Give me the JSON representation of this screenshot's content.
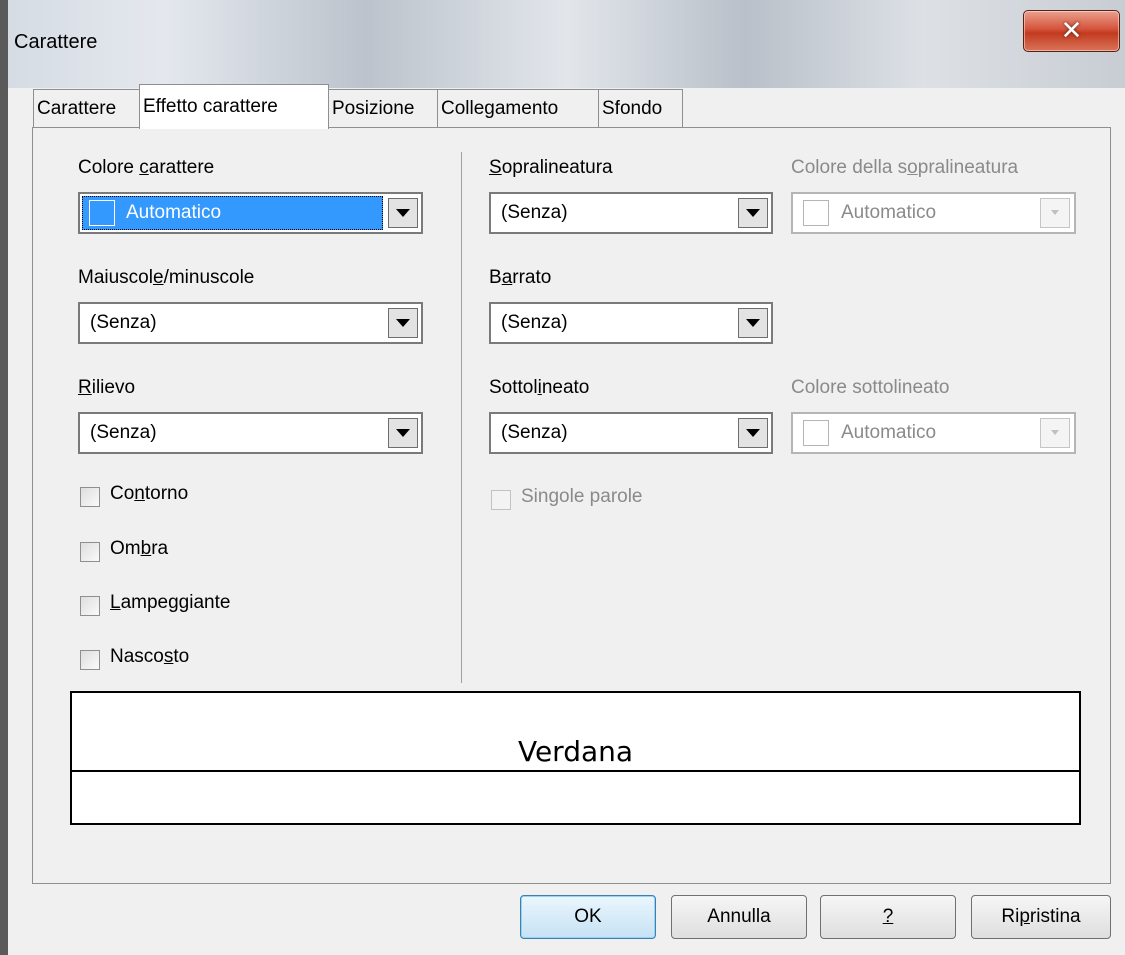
{
  "window": {
    "title": "Carattere",
    "close_glyph": "✕"
  },
  "tabs": [
    {
      "label": "Carattere",
      "active": false
    },
    {
      "label": "Effetto carattere",
      "active": true
    },
    {
      "label": "Posizione",
      "active": false
    },
    {
      "label": "Collegamento",
      "active": false
    },
    {
      "label": "Sfondo",
      "active": false
    }
  ],
  "left_column": {
    "font_color": {
      "label_pre": "Colore ",
      "label_key": "c",
      "label_post": "arattere",
      "value": "Automatico"
    },
    "case": {
      "label_pre": "Maiuscol",
      "label_key": "e",
      "label_post": "/minuscole",
      "value": "(Senza)"
    },
    "relief": {
      "label_pre": "",
      "label_key": "R",
      "label_post": "ilievo",
      "value": "(Senza)"
    },
    "checkboxes": [
      {
        "pre": "Co",
        "key": "n",
        "post": "torno",
        "checked": false
      },
      {
        "pre": "Om",
        "key": "b",
        "post": "ra",
        "checked": false
      },
      {
        "pre": "",
        "key": "L",
        "post": "ampeggiante",
        "checked": false
      },
      {
        "pre": "Nasco",
        "key": "s",
        "post": "to",
        "checked": false
      }
    ]
  },
  "right_column": {
    "overline": {
      "label_pre": "",
      "label_key": "S",
      "label_post": "opralineatura",
      "value": "(Senza)"
    },
    "overline_color": {
      "label_pre": "Colore della s",
      "label_key": "o",
      "label_post": "pralineatura",
      "value": "Automatico",
      "disabled": true
    },
    "strikethrough": {
      "label_pre": "B",
      "label_key": "a",
      "label_post": "rrato",
      "value": "(Senza)"
    },
    "underline": {
      "label_pre": "Sottol",
      "label_key": "i",
      "label_post": "neato",
      "value": "(Senza)"
    },
    "underline_color": {
      "label": "Colore sottolineato",
      "value": "Automatico",
      "disabled": true
    },
    "individual_words": {
      "pre": "Sin",
      "key": "g",
      "post": "ole parole",
      "checked": false,
      "disabled": true
    }
  },
  "preview": {
    "text": "Verdana"
  },
  "buttons": {
    "ok": "OK",
    "cancel": "Annulla",
    "help": "?",
    "reset_pre": "Ri",
    "reset_key": "p",
    "reset_post": "ristina"
  },
  "colors": {
    "selection": "#3399ff",
    "disabled_text": "#8a8a8a",
    "close_button": "#c23a1f",
    "default_button_border": "#3c7fb1"
  }
}
